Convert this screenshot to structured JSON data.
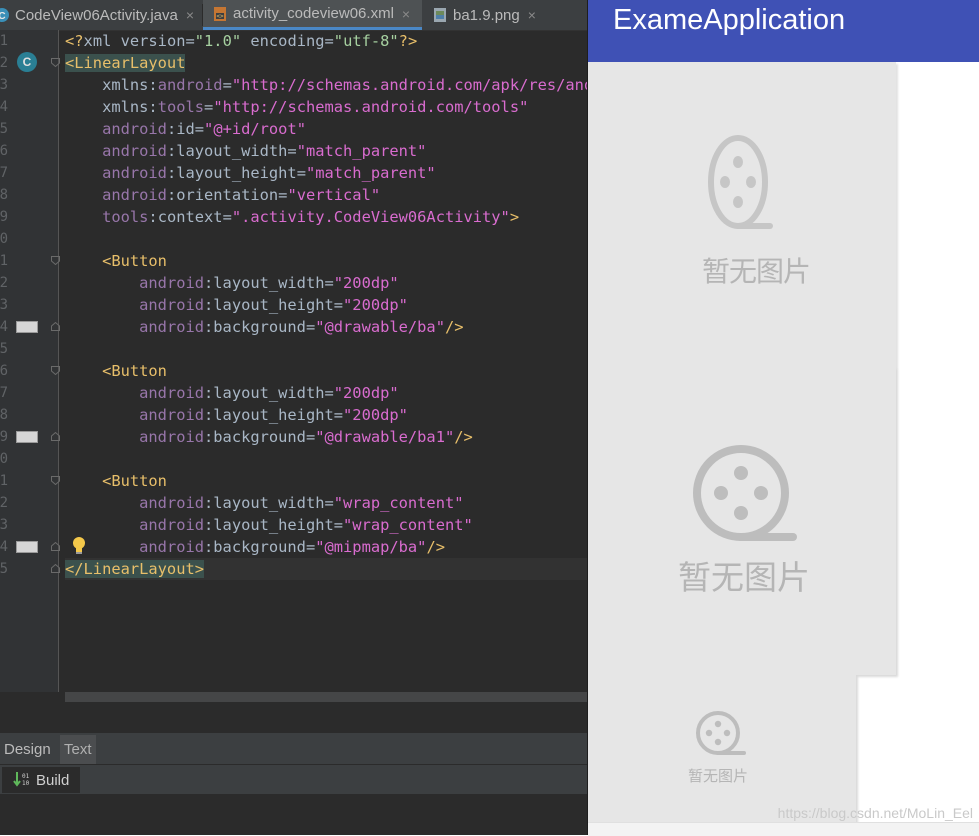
{
  "tabs": [
    {
      "label": "CodeView06Activity.java",
      "icon": "java-class-icon",
      "close": "×"
    },
    {
      "label": "activity_codeview06.xml",
      "icon": "xml-file-icon",
      "close": "×"
    },
    {
      "label": "ba1.9.png",
      "icon": "image-file-icon",
      "close": "×"
    }
  ],
  "gutter": {
    "line_numbers": [
      "1",
      "2",
      "3",
      "4",
      "5",
      "6",
      "7",
      "8",
      "9",
      "0",
      "1",
      "2",
      "3",
      "4",
      "5",
      "6",
      "7",
      "8",
      "9",
      "0",
      "1",
      "2",
      "3",
      "4",
      "5"
    ],
    "class_badge": "C"
  },
  "code": {
    "l1": [
      "<?",
      "xml version",
      "=",
      "\"1.0\"",
      " encoding",
      "=",
      "\"utf-8\"",
      "?>"
    ],
    "l2": [
      "<LinearLayout"
    ],
    "l3": [
      "xmlns:",
      "android",
      "=",
      "\"http://schemas.android.com/apk/res/android\""
    ],
    "l4": [
      "xmlns:",
      "tools",
      "=",
      "\"http://schemas.android.com/tools\""
    ],
    "l5": [
      "android",
      ":id",
      "=",
      "\"@+id/root\""
    ],
    "l6": [
      "android",
      ":layout_width",
      "=",
      "\"match_parent\""
    ],
    "l7": [
      "android",
      ":layout_height",
      "=",
      "\"match_parent\""
    ],
    "l8": [
      "android",
      ":orientation",
      "=",
      "\"vertical\""
    ],
    "l9": [
      "tools",
      ":context",
      "=",
      "\".activity.CodeView06Activity\"",
      ">"
    ],
    "b1_open": "<Button",
    "b1_w": [
      "android",
      ":layout_width",
      "=",
      "\"200dp\""
    ],
    "b1_h": [
      "android",
      ":layout_height",
      "=",
      "\"200dp\""
    ],
    "b1_bg": [
      "android",
      ":background",
      "=",
      "\"@drawable/ba\"",
      "/>"
    ],
    "b2_open": "<Button",
    "b2_w": [
      "android",
      ":layout_width",
      "=",
      "\"200dp\""
    ],
    "b2_h": [
      "android",
      ":layout_height",
      "=",
      "\"200dp\""
    ],
    "b2_bg": [
      "android",
      ":background",
      "=",
      "\"@drawable/ba1\"",
      "/>"
    ],
    "b3_open": "<Button",
    "b3_w": [
      "android",
      ":layout_width",
      "=",
      "\"wrap_content\""
    ],
    "b3_h": [
      "android",
      ":layout_height",
      "=",
      "\"wrap_content\""
    ],
    "b3_bg": [
      "android",
      ":background",
      "=",
      "\"@mipmap/ba\"",
      "/>"
    ],
    "close": "</LinearLayout>"
  },
  "mode_tabs": {
    "design": "Design",
    "text": "Text"
  },
  "build": {
    "label": "Build"
  },
  "preview": {
    "app_title": "ExameApplication",
    "placeholder_text": "暂无图片",
    "watermark": "https://blog.csdn.net/MoLin_Eel"
  },
  "colors": {
    "app_bar": "#3f51b5",
    "editor_bg": "#2b2b2b",
    "placeholder_gray": "#b5b5b5"
  }
}
